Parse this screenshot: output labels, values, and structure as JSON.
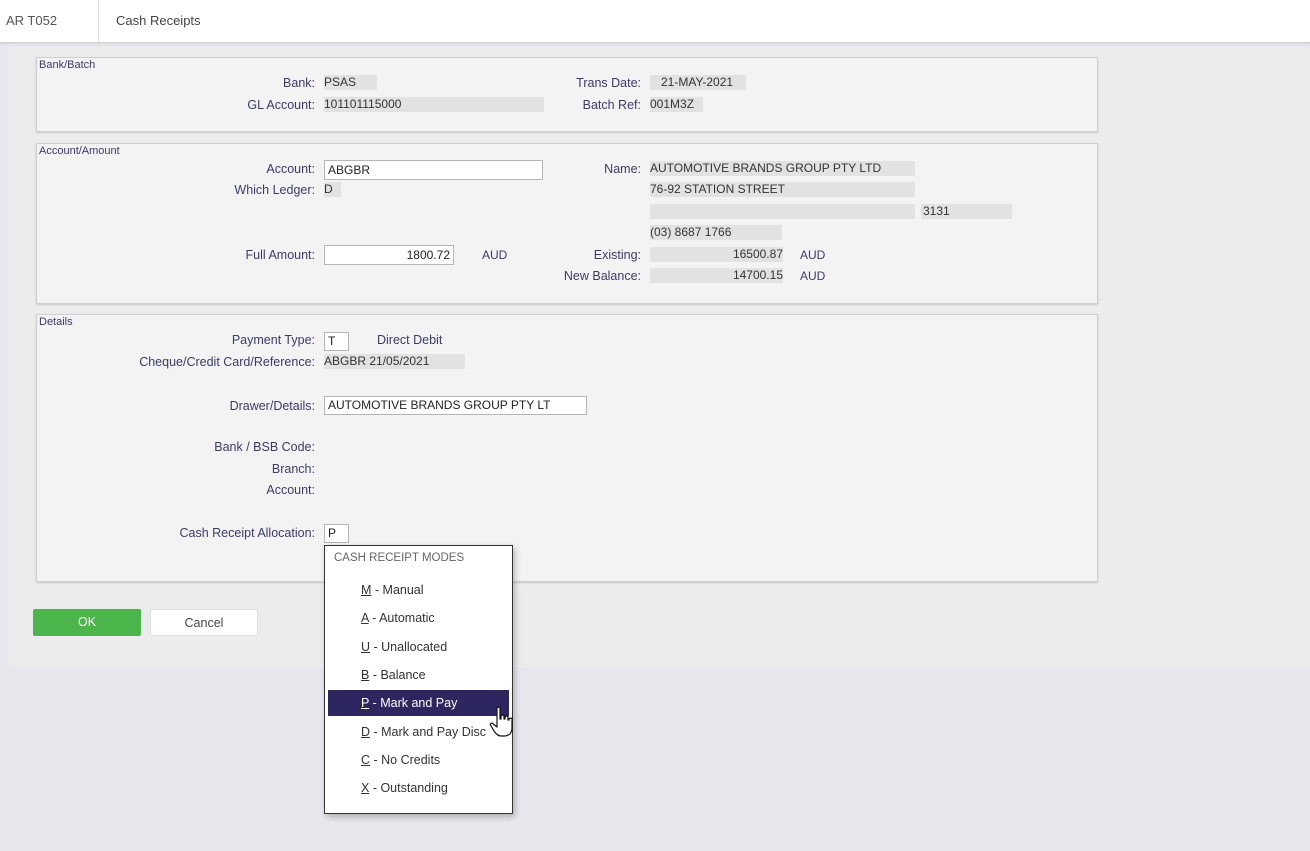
{
  "header": {
    "screen_code": "AR T052",
    "title": "Cash Receipts"
  },
  "bank_batch": {
    "title": "Bank/Batch",
    "bank_label": "Bank:",
    "bank": "PSAS",
    "gl_label": "GL Account:",
    "gl_account": "101101115000",
    "trans_date_label": "Trans Date:",
    "trans_date": "21-MAY-2021",
    "batch_ref_label": "Batch Ref:",
    "batch_ref": "001M3Z"
  },
  "account_amount": {
    "title": "Account/Amount",
    "account_label": "Account:",
    "account": "ABGBR",
    "ledger_label": "Which Ledger:",
    "ledger": "D",
    "full_amount_label": "Full Amount:",
    "full_amount": "1800.72",
    "full_amount_currency": "AUD",
    "name_label": "Name:",
    "name": "AUTOMOTIVE BRANDS GROUP PTY LTD",
    "address1": "76-92 STATION STREET",
    "address2": "",
    "postcode": "3131",
    "phone": "(03) 8687 1766",
    "existing_label": "Existing:",
    "existing": "16500.87",
    "existing_currency": "AUD",
    "new_balance_label": "New Balance:",
    "new_balance": "14700.15",
    "new_balance_currency": "AUD"
  },
  "details": {
    "title": "Details",
    "payment_type_label": "Payment Type:",
    "payment_type": "T",
    "payment_type_desc": "Direct Debit",
    "reference_label": "Cheque/Credit Card/Reference:",
    "reference": "ABGBR 21/05/2021",
    "drawer_label": "Drawer/Details:",
    "drawer": "AUTOMOTIVE BRANDS GROUP PTY LT",
    "bsb_label": "Bank / BSB Code:",
    "branch_label": "Branch:",
    "account_label": "Account:",
    "allocation_label": "Cash Receipt Allocation:",
    "allocation": "P"
  },
  "buttons": {
    "ok": "OK",
    "cancel": "Cancel"
  },
  "dropdown": {
    "header": "CASH RECEIPT MODES",
    "options": [
      {
        "key": "M",
        "rest": " - Manual"
      },
      {
        "key": "A",
        "rest": " - Automatic"
      },
      {
        "key": "U",
        "rest": " - Unallocated"
      },
      {
        "key": "B",
        "rest": " - Balance"
      },
      {
        "key": "P",
        "rest": " - Mark and Pay",
        "selected": true
      },
      {
        "key": "D",
        "rest": " - Mark and Pay Disc"
      },
      {
        "key": "C",
        "rest": " - No Credits"
      },
      {
        "key": "X",
        "rest": " - Outstanding"
      }
    ]
  },
  "colors": {
    "ok_button": "#4bb54b",
    "selected_option": "#2d2660",
    "label_text": "#3b3b6b"
  }
}
